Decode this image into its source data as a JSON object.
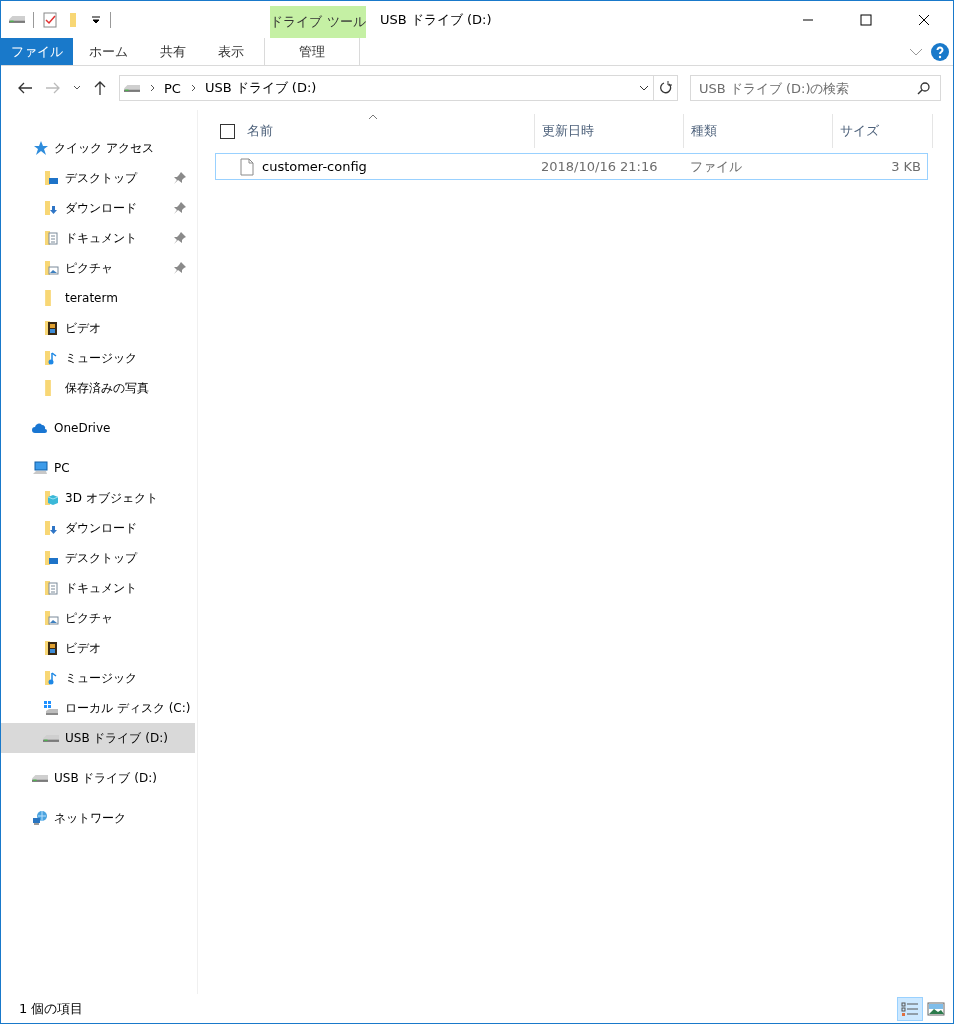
{
  "window": {
    "title": "USB ドライブ (D:)",
    "context_label": "ドライブ ツール"
  },
  "ribbon_tabs": [
    {
      "label": "ファイル",
      "kind": "file",
      "selected": false
    },
    {
      "label": "ホーム",
      "kind": "tab",
      "selected": false
    },
    {
      "label": "共有",
      "kind": "tab",
      "selected": false
    },
    {
      "label": "表示",
      "kind": "tab",
      "selected": false
    },
    {
      "label": "管理",
      "kind": "context",
      "selected": false
    }
  ],
  "address": {
    "path": [
      "PC",
      "USB ドライブ (D:)"
    ],
    "search_placeholder": "USB ドライブ (D:)の検索"
  },
  "sidebar": {
    "items": [
      {
        "label": "クイック アクセス",
        "kind": "star",
        "selected": false,
        "children": [
          {
            "label": "デスクトップ",
            "kind": "desktop",
            "pinned": true,
            "selected": false
          },
          {
            "label": "ダウンロード",
            "kind": "download",
            "pinned": true,
            "selected": false
          },
          {
            "label": "ドキュメント",
            "kind": "document",
            "pinned": true,
            "selected": false
          },
          {
            "label": "ピクチャ",
            "kind": "picture",
            "pinned": true,
            "selected": false
          },
          {
            "label": "teraterm",
            "kind": "folder",
            "pinned": false,
            "selected": false
          },
          {
            "label": "ビデオ",
            "kind": "video",
            "pinned": false,
            "selected": false
          },
          {
            "label": "ミュージック",
            "kind": "music",
            "pinned": false,
            "selected": false
          },
          {
            "label": "保存済みの写真",
            "kind": "folder",
            "pinned": false,
            "selected": false
          }
        ]
      },
      {
        "label": "OneDrive",
        "kind": "cloud",
        "selected": false
      },
      {
        "label": "PC",
        "kind": "pc",
        "selected": false,
        "children": [
          {
            "label": "3D オブジェクト",
            "kind": "cube",
            "selected": false
          },
          {
            "label": "ダウンロード",
            "kind": "download",
            "selected": false
          },
          {
            "label": "デスクトップ",
            "kind": "desktop",
            "selected": false
          },
          {
            "label": "ドキュメント",
            "kind": "document",
            "selected": false
          },
          {
            "label": "ピクチャ",
            "kind": "picture",
            "selected": false
          },
          {
            "label": "ビデオ",
            "kind": "video",
            "selected": false
          },
          {
            "label": "ミュージック",
            "kind": "music",
            "selected": false
          },
          {
            "label": "ローカル ディスク (C:)",
            "kind": "disk",
            "selected": false
          },
          {
            "label": "USB ドライブ (D:)",
            "kind": "usb",
            "selected": true
          }
        ]
      },
      {
        "label": "USB ドライブ (D:)",
        "kind": "usb",
        "selected": false
      },
      {
        "label": "ネットワーク",
        "kind": "network",
        "selected": false
      }
    ]
  },
  "table": {
    "select_all": {
      "checked": false
    },
    "columns": [
      "名前",
      "更新日時",
      "種類",
      "サイズ"
    ],
    "rows": [
      {
        "name": "customer-config",
        "modified": "2018/10/16 21:16",
        "type": "ファイル",
        "size": "3 KB",
        "selected": true
      }
    ]
  },
  "status_bar": {
    "text": "1 個の項目",
    "views": [
      {
        "kind": "details",
        "selected": true
      },
      {
        "kind": "large",
        "selected": false
      }
    ]
  }
}
